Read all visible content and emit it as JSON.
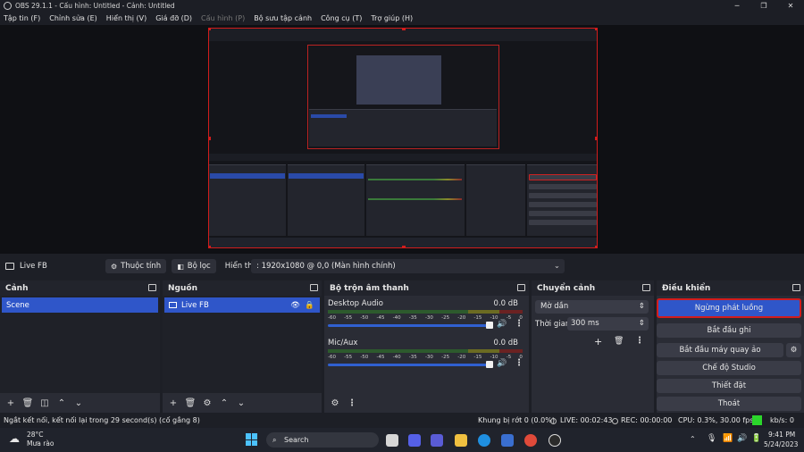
{
  "window": {
    "title": "OBS 29.1.1 - Cấu hình: Untitled - Cảnh: Untitled",
    "minimize": "─",
    "maximize": "❐",
    "close": "✕"
  },
  "menu": [
    "Tập tin (F)",
    "Chỉnh sửa (E)",
    "Hiển thị (V)",
    "Giá đỡ (D)",
    "Cấu hình (P)",
    "Bộ sưu tập cảnh",
    "Công cụ (T)",
    "Trợ giúp (H)"
  ],
  "source_toolbar": {
    "source_name": "Live FB",
    "properties_label": "Thuộc tính",
    "filters_label": "Bộ lọc",
    "display_label": "Hiển thị",
    "display_value": ": 1920x1080 @ 0,0 (Màn hình chính)"
  },
  "scenes": {
    "title": "Cảnh",
    "items": [
      "Scene"
    ]
  },
  "sources": {
    "title": "Nguồn",
    "items": [
      "Live FB"
    ]
  },
  "mixer": {
    "title": "Bộ trộn âm thanh",
    "channels": [
      {
        "name": "Desktop Audio",
        "db": "0.0 dB",
        "level": 0.74
      },
      {
        "name": "Mic/Aux",
        "db": "0.0 dB",
        "level": 0.55
      }
    ],
    "ticks": [
      "-60",
      "-55",
      "-50",
      "-45",
      "-40",
      "-35",
      "-30",
      "-25",
      "-20",
      "-15",
      "-10",
      "-5",
      "0"
    ]
  },
  "transitions": {
    "title": "Chuyển cảnh",
    "type_value": "Mờ dần",
    "duration_label": "Thời gian",
    "duration_value": "300 ms"
  },
  "controls": {
    "title": "Điều khiển",
    "stop_streaming": "Ngừng phát luồng",
    "start_recording": "Bắt đầu ghi",
    "start_virtualcam": "Bắt đầu máy quay ảo",
    "studio_mode": "Chế độ Studio",
    "settings": "Thiết đặt",
    "exit": "Thoát"
  },
  "status": {
    "message": "Ngắt kết nối, kết nối lại trong 29 second(s) (cố gắng 8)",
    "dropped": "Khung bị rớt 0 (0.0%)",
    "live": "LIVE: 00:02:43",
    "rec": "REC: 00:00:00",
    "cpu": "CPU: 0.3%, 30.00 fps",
    "kbs": "kb/s: 0"
  },
  "taskbar": {
    "temperature": "28°C",
    "weather": "Mưa rào",
    "search": "Search",
    "time": "9:41 PM",
    "date": "5/24/2023"
  },
  "colors": {
    "accent": "#2f56c9",
    "live_border": "#d21c1c",
    "status_green": "#2bd62b"
  }
}
